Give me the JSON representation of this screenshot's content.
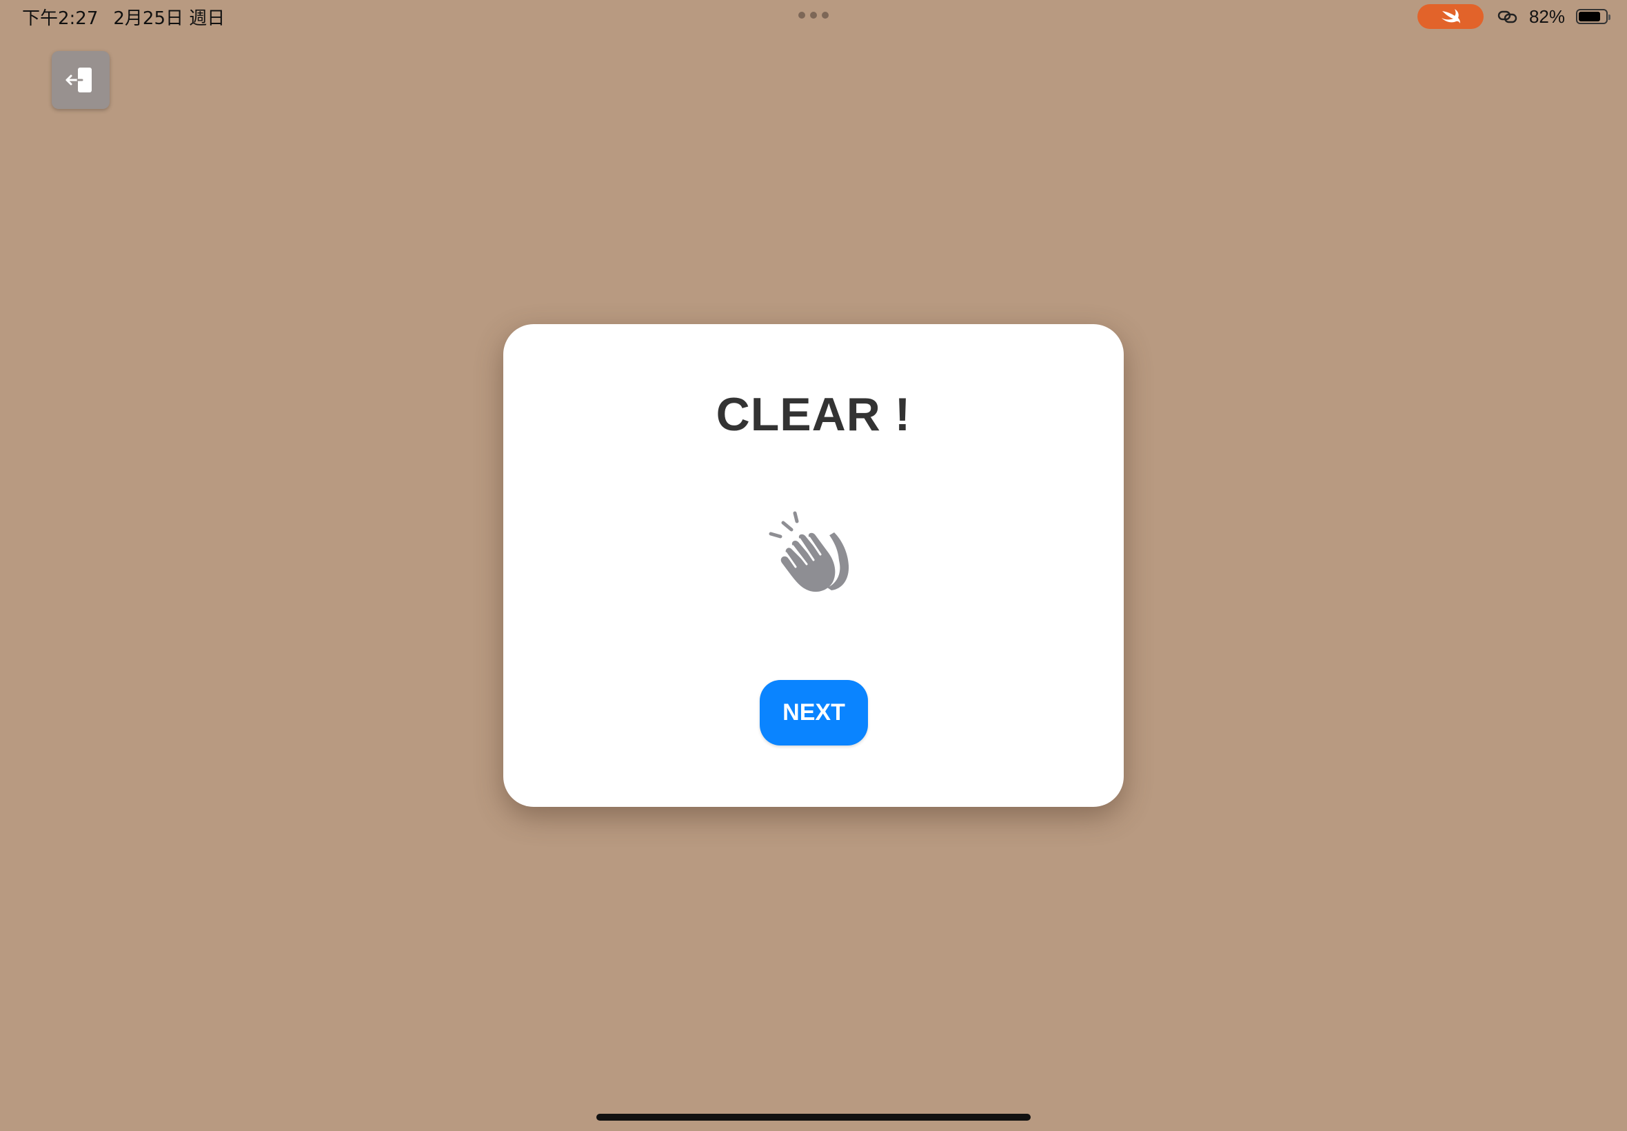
{
  "status_bar": {
    "time": "下午2:27",
    "date": "2月25日 週日",
    "battery_text": "82%",
    "battery_level": 0.82,
    "icons": [
      "swift-icon",
      "link-icon",
      "battery-icon"
    ]
  },
  "exit_button": {
    "icon": "exit-door-icon"
  },
  "card": {
    "title": "CLEAR !",
    "icon": "clapping-hands-icon",
    "next_label": "NEXT"
  },
  "colors": {
    "background": "#b89a81",
    "card": "#ffffff",
    "title": "#333333",
    "accent_button": "#0a84ff",
    "icon_gray": "#8e8e93",
    "swift_orange": "#e2632a"
  }
}
